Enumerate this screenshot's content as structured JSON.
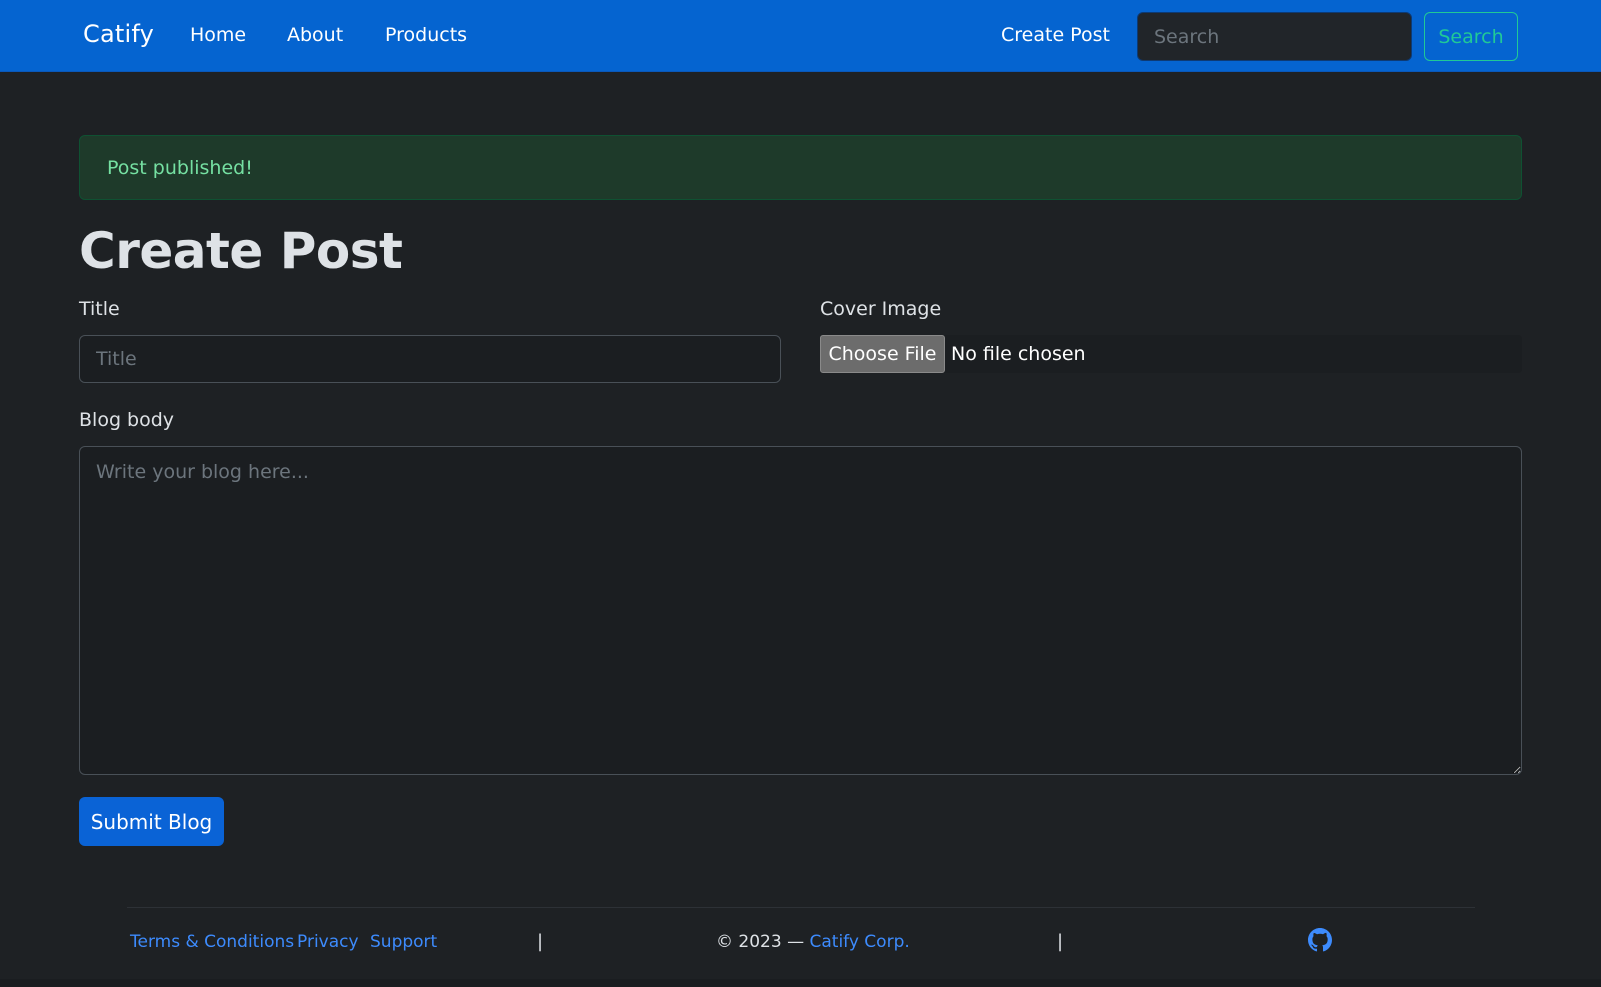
{
  "navbar": {
    "brand": "Catify",
    "links": [
      "Home",
      "About",
      "Products"
    ],
    "create_post": "Create Post",
    "search_placeholder": "Search",
    "search_button": "Search"
  },
  "alert": {
    "message": "Post published!"
  },
  "form": {
    "heading": "Create Post",
    "title_label": "Title",
    "title_placeholder": "Title",
    "cover_label": "Cover Image",
    "file_button": "Choose File",
    "file_status": "No file chosen",
    "body_label": "Blog body",
    "body_placeholder": "Write your blog here...",
    "submit": "Submit Blog"
  },
  "footer": {
    "links": [
      "Terms & Conditions",
      "Privacy",
      "Support"
    ],
    "separator": "|",
    "copyright_prefix": "© 2023 — ",
    "copyright_corp": "Catify Corp.",
    "github_icon": "github-icon"
  },
  "colors": {
    "navbar": "#0564d0",
    "background": "#1e2124",
    "accent": "#20c997",
    "link": "#3d8bfd",
    "alert_text": "#75e0a2"
  }
}
